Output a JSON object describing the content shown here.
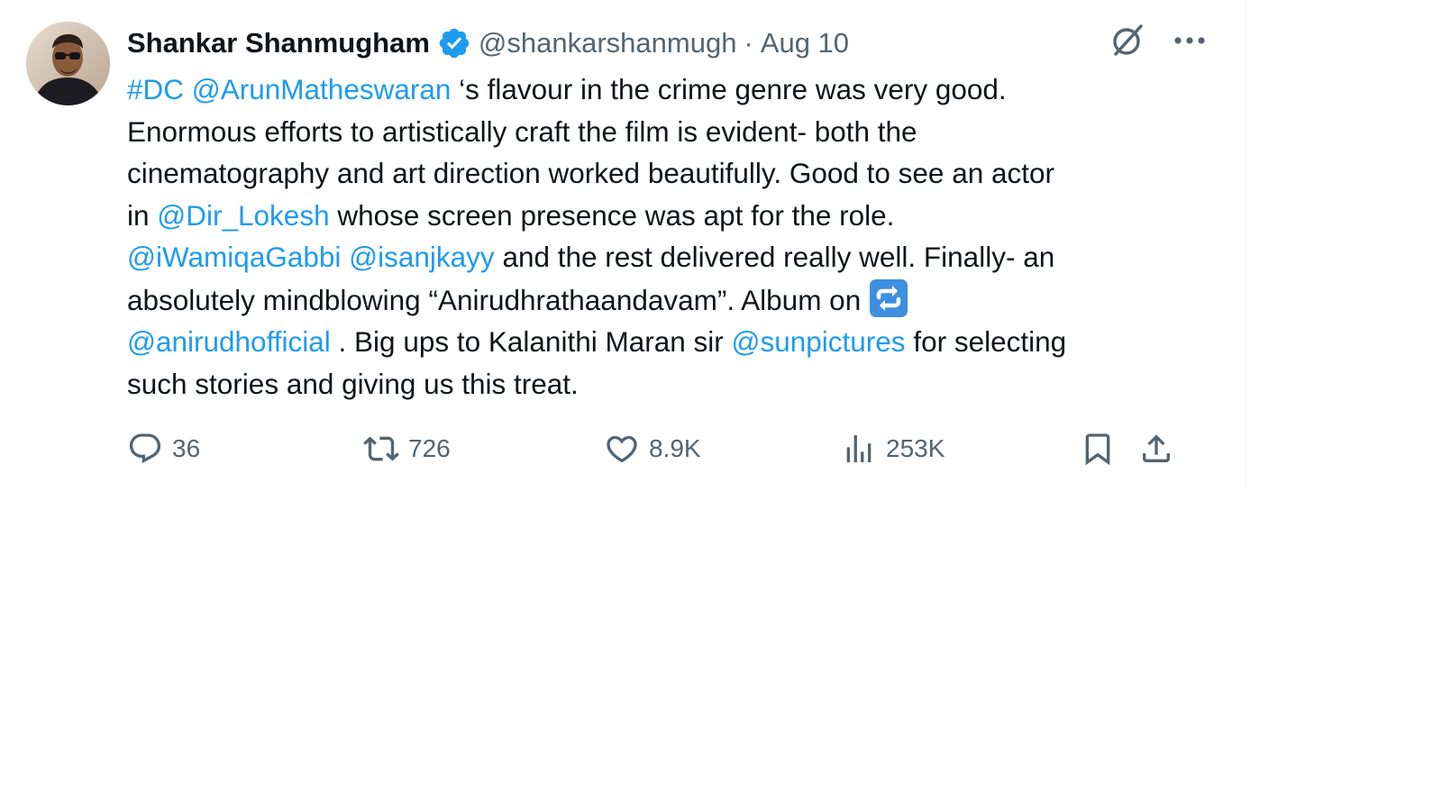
{
  "tweet": {
    "author_name": "Shankar Shanmugham",
    "handle": "@shankarshanmugh",
    "separator": "·",
    "date": "Aug 10",
    "body": [
      [
        {
          "t": "#DC",
          "link": true
        },
        {
          "t": " "
        },
        {
          "t": "@ArunMatheswaran",
          "link": true
        },
        {
          "t": " ‘s flavour in the crime genre was very good."
        }
      ],
      [
        {
          "t": "Enormous efforts to artistically craft the film is evident- both the"
        }
      ],
      [
        {
          "t": "cinematography and art direction worked beautifully. Good to see an actor"
        }
      ],
      [
        {
          "t": "in "
        },
        {
          "t": "@Dir_Lokesh",
          "link": true
        },
        {
          "t": " whose screen presence was apt for the role."
        }
      ],
      [
        {
          "t": "@iWamiqaGabbi",
          "link": true
        },
        {
          "t": " "
        },
        {
          "t": "@isanjkayy",
          "link": true
        },
        {
          "t": " and the rest delivered really well. Finally- an"
        }
      ],
      [
        {
          "t": "absolutely mindblowing “Anirudhrathaandavam”. Album on "
        },
        {
          "emoji": "repeat-button-emoji"
        }
      ],
      [
        {
          "t": "@anirudhofficial",
          "link": true
        },
        {
          "t": " . Big ups to Kalanithi Maran sir "
        },
        {
          "t": "@sunpictures",
          "link": true
        },
        {
          "t": " for selecting"
        }
      ],
      [
        {
          "t": "such stories and giving us this treat."
        }
      ]
    ],
    "stats": {
      "replies": "36",
      "reposts": "726",
      "likes": "8.9K",
      "views": "253K"
    }
  },
  "icons": {
    "verified": "verified-badge-icon",
    "grok": "grok-icon",
    "more": "more-options-icon",
    "reply": "reply-icon",
    "repost": "repost-icon",
    "like": "like-icon",
    "views": "views-icon",
    "bookmark": "bookmark-icon",
    "share": "share-icon"
  },
  "colors": {
    "link": "#1d9bf0",
    "text": "#0f1419",
    "secondary": "#536471",
    "divider": "#eff3f4"
  }
}
